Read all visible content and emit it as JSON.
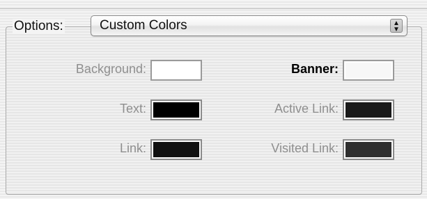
{
  "options": {
    "label": "Options:",
    "popup_value": "Custom Colors"
  },
  "icons": {
    "popup_arrows": "up-down-arrows-icon"
  },
  "fields": {
    "background": {
      "label": "Background:",
      "color": "#ffffff"
    },
    "banner": {
      "label": "Banner:",
      "color": "#f7f7f7"
    },
    "text": {
      "label": "Text:",
      "color": "#000000"
    },
    "active_link": {
      "label": "Active Link:",
      "color": "#1a1a1a"
    },
    "link": {
      "label": "Link:",
      "color": "#111111"
    },
    "visited_link": {
      "label": "Visited Link:",
      "color": "#2f2f2f"
    }
  }
}
